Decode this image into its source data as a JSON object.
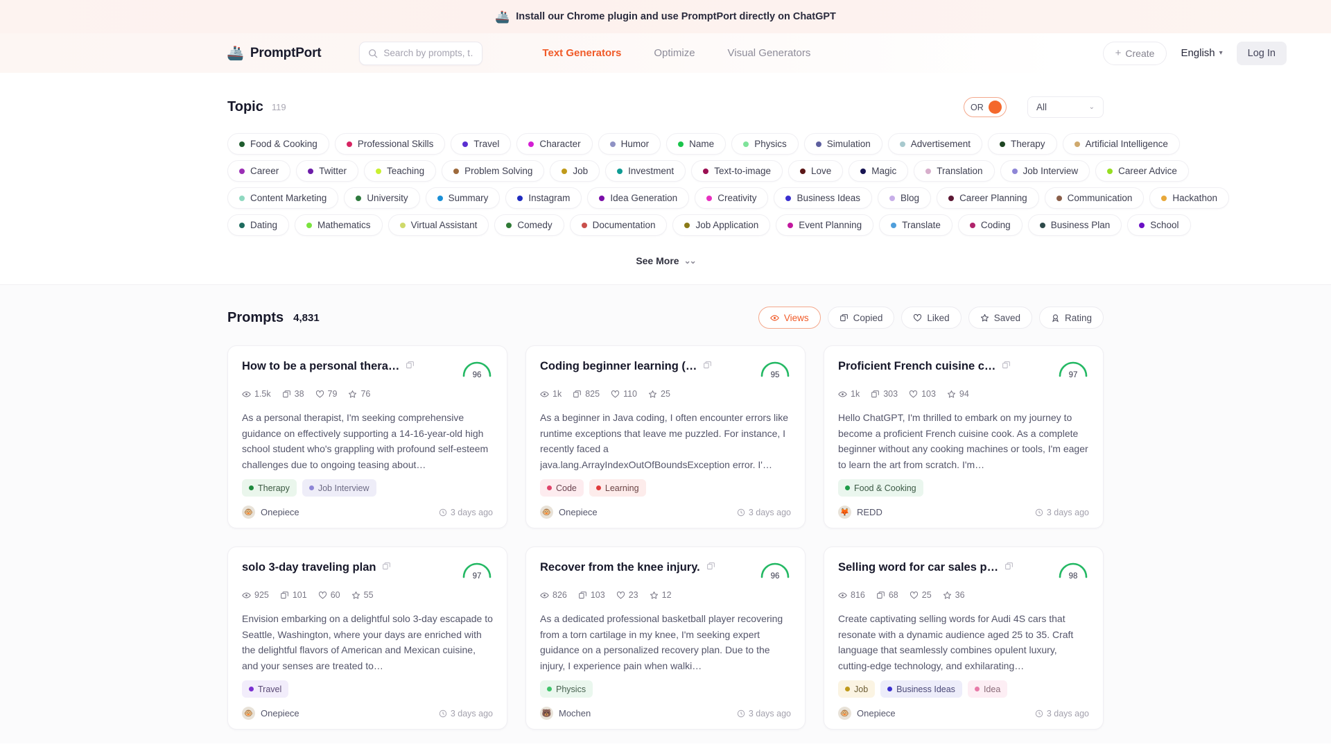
{
  "banner": {
    "icon": "ship-chrome-icon",
    "text": "Install our Chrome plugin and use PromptPort directly on ChatGPT"
  },
  "header": {
    "logo_icon": "ship-icon",
    "brand": "PromptPort",
    "search_placeholder": "Search by prompts, t…",
    "search_icon": "search-icon",
    "nav": [
      {
        "label": "Text Generators",
        "active": true
      },
      {
        "label": "Optimize",
        "active": false
      },
      {
        "label": "Visual Generators",
        "active": false
      }
    ],
    "create_label": "Create",
    "create_plus": "+",
    "language": "English",
    "login_label": "Log In",
    "accent": "#f05a28"
  },
  "topic": {
    "title": "Topic",
    "count": "119",
    "logic_toggle": "OR",
    "filter_value": "All",
    "see_more": "See More",
    "rows": [
      [
        {
          "label": "Food & Cooking",
          "color": "#1f5c2e"
        },
        {
          "label": "Professional Skills",
          "color": "#d62462"
        },
        {
          "label": "Travel",
          "color": "#5a2fd1"
        },
        {
          "label": "Character",
          "color": "#d41fd4"
        },
        {
          "label": "Humor",
          "color": "#8f92c4"
        },
        {
          "label": "Name",
          "color": "#19c44a"
        },
        {
          "label": "Physics",
          "color": "#7fe39a"
        },
        {
          "label": "Simulation",
          "color": "#5d5f9e"
        },
        {
          "label": "Advertisement",
          "color": "#a8c9ce"
        },
        {
          "label": "Therapy",
          "color": "#1e4522"
        },
        {
          "label": "Artificial Intelligence",
          "color": "#cfa96d"
        }
      ],
      [
        {
          "label": "Career",
          "color": "#9b2fb5"
        },
        {
          "label": "Twitter",
          "color": "#6c1da8"
        },
        {
          "label": "Teaching",
          "color": "#c9f031"
        },
        {
          "label": "Problem Solving",
          "color": "#9e6a3c"
        },
        {
          "label": "Job",
          "color": "#c09a1a"
        },
        {
          "label": "Investment",
          "color": "#0f9c94"
        },
        {
          "label": "Text-to-image",
          "color": "#9b0f52"
        },
        {
          "label": "Love",
          "color": "#5b1717"
        },
        {
          "label": "Magic",
          "color": "#171452"
        },
        {
          "label": "Translation",
          "color": "#d7aecb"
        },
        {
          "label": "Job Interview",
          "color": "#8e86d6"
        },
        {
          "label": "Career Advice",
          "color": "#96de22"
        }
      ],
      [
        {
          "label": "Content Marketing",
          "color": "#8fd8c0"
        },
        {
          "label": "University",
          "color": "#2f7a3e"
        },
        {
          "label": "Summary",
          "color": "#1a8fd6"
        },
        {
          "label": "Instagram",
          "color": "#1f2bbf"
        },
        {
          "label": "Idea Generation",
          "color": "#7a0fa8"
        },
        {
          "label": "Creativity",
          "color": "#e830c0"
        },
        {
          "label": "Business Ideas",
          "color": "#3a2fcf"
        },
        {
          "label": "Blog",
          "color": "#c7aee8"
        },
        {
          "label": "Career Planning",
          "color": "#5c1733"
        },
        {
          "label": "Communication",
          "color": "#8a5f4a"
        },
        {
          "label": "Hackathon",
          "color": "#e8a83a"
        }
      ],
      [
        {
          "label": "Dating",
          "color": "#1d6b5e"
        },
        {
          "label": "Mathematics",
          "color": "#7ae33f"
        },
        {
          "label": "Virtual Assistant",
          "color": "#cfd96a"
        },
        {
          "label": "Comedy",
          "color": "#2f7a36"
        },
        {
          "label": "Documentation",
          "color": "#c9504c"
        },
        {
          "label": "Job Application",
          "color": "#8a7a18"
        },
        {
          "label": "Event Planning",
          "color": "#c2189e"
        },
        {
          "label": "Translate",
          "color": "#4f9edb"
        },
        {
          "label": "Coding",
          "color": "#b0246b"
        },
        {
          "label": "Business Plan",
          "color": "#2e4a4a"
        },
        {
          "label": "School",
          "color": "#6a0fc4"
        }
      ]
    ]
  },
  "prompts": {
    "title": "Prompts",
    "count": "4,831",
    "sorts": [
      {
        "label": "Views",
        "icon": "eye-icon",
        "active": true
      },
      {
        "label": "Copied",
        "icon": "copy-icon",
        "active": false
      },
      {
        "label": "Liked",
        "icon": "heart-icon",
        "active": false
      },
      {
        "label": "Saved",
        "icon": "star-icon",
        "active": false
      },
      {
        "label": "Rating",
        "icon": "rating-icon",
        "active": false
      }
    ],
    "cards": [
      {
        "title": "How to be a personal thera…",
        "score": "96",
        "views": "1.5k",
        "copied": "38",
        "liked": "79",
        "saved": "76",
        "excerpt": "As a personal therapist, I'm seeking comprehensive guidance on effectively supporting a 14-16-year-old high school student who's grappling with profound self-esteem challenges due to ongoing teasing about…",
        "chips": [
          {
            "label": "Therapy",
            "color": "#1e8a3c",
            "bg": "#eaf6ec",
            "fg": "#3c5a42"
          },
          {
            "label": "Job Interview",
            "color": "#8e86d6",
            "bg": "#eeedf8",
            "fg": "#6d6b85"
          }
        ],
        "author": "Onepiece",
        "avatar": "🐵",
        "time": "3 days ago"
      },
      {
        "title": "Coding beginner learning (…",
        "score": "95",
        "views": "1k",
        "copied": "825",
        "liked": "110",
        "saved": "25",
        "excerpt": "As a beginner in Java coding, I often encounter errors like runtime exceptions that leave me puzzled. For instance, I recently faced a java.lang.ArrayIndexOutOfBoundsException error. I'…",
        "chips": [
          {
            "label": "Code",
            "color": "#e0436b",
            "bg": "#fdecef",
            "fg": "#6b4450"
          },
          {
            "label": "Learning",
            "color": "#e03a3a",
            "bg": "#fdeceb",
            "fg": "#6b4444"
          }
        ],
        "author": "Onepiece",
        "avatar": "🐵",
        "time": "3 days ago"
      },
      {
        "title": "Proficient French cuisine c…",
        "score": "97",
        "views": "1k",
        "copied": "303",
        "liked": "103",
        "saved": "94",
        "excerpt": "Hello ChatGPT, I'm thrilled to embark on my journey to become a proficient French cuisine cook. As a complete beginner without any cooking machines or tools, I'm eager to learn the art from scratch. I'm…",
        "chips": [
          {
            "label": "Food & Cooking",
            "color": "#1f9c4a",
            "bg": "#eaf6ee",
            "fg": "#3c5a45"
          }
        ],
        "author": "REDD",
        "avatar": "🦊",
        "time": "3 days ago"
      },
      {
        "title": "solo 3-day traveling plan",
        "score": "97",
        "views": "925",
        "copied": "101",
        "liked": "60",
        "saved": "55",
        "excerpt": "Envision embarking on a delightful solo 3-day escapade to Seattle, Washington, where your days are enriched with the delightful flavors of American and Mexican cuisine, and your senses are treated to…",
        "chips": [
          {
            "label": "Travel",
            "color": "#7a2fd1",
            "bg": "#f2edfb",
            "fg": "#5a4a75"
          }
        ],
        "author": "Onepiece",
        "avatar": "🐵",
        "time": "3 days ago"
      },
      {
        "title": "Recover from the knee injury.",
        "score": "96",
        "views": "826",
        "copied": "103",
        "liked": "23",
        "saved": "12",
        "excerpt": "As a dedicated professional basketball player recovering from a torn cartilage in my knee, I'm seeking expert guidance on a personalized recovery plan. Due to the injury, I experience pain when walki…",
        "chips": [
          {
            "label": "Physics",
            "color": "#3fc46a",
            "bg": "#eaf7ee",
            "fg": "#46614f"
          }
        ],
        "author": "Mochen",
        "avatar": "🐻",
        "time": "3 days ago"
      },
      {
        "title": "Selling word for car sales p…",
        "score": "98",
        "views": "816",
        "copied": "68",
        "liked": "25",
        "saved": "36",
        "excerpt": "Create captivating selling words for Audi 4S cars that resonate with a dynamic audience aged 25 to 35. Craft language that seamlessly combines opulent luxury, cutting-edge technology, and exhilarating…",
        "chips": [
          {
            "label": "Job",
            "color": "#c09a1a",
            "bg": "#fbf4e3",
            "fg": "#6b5c33"
          },
          {
            "label": "Business Ideas",
            "color": "#3a2fcf",
            "bg": "#ededfa",
            "fg": "#4a4877"
          },
          {
            "label": "Idea",
            "color": "#e87aa8",
            "bg": "#fdeef4",
            "fg": "#8a6b78"
          }
        ],
        "author": "Onepiece",
        "avatar": "🐵",
        "time": "3 days ago"
      }
    ]
  }
}
